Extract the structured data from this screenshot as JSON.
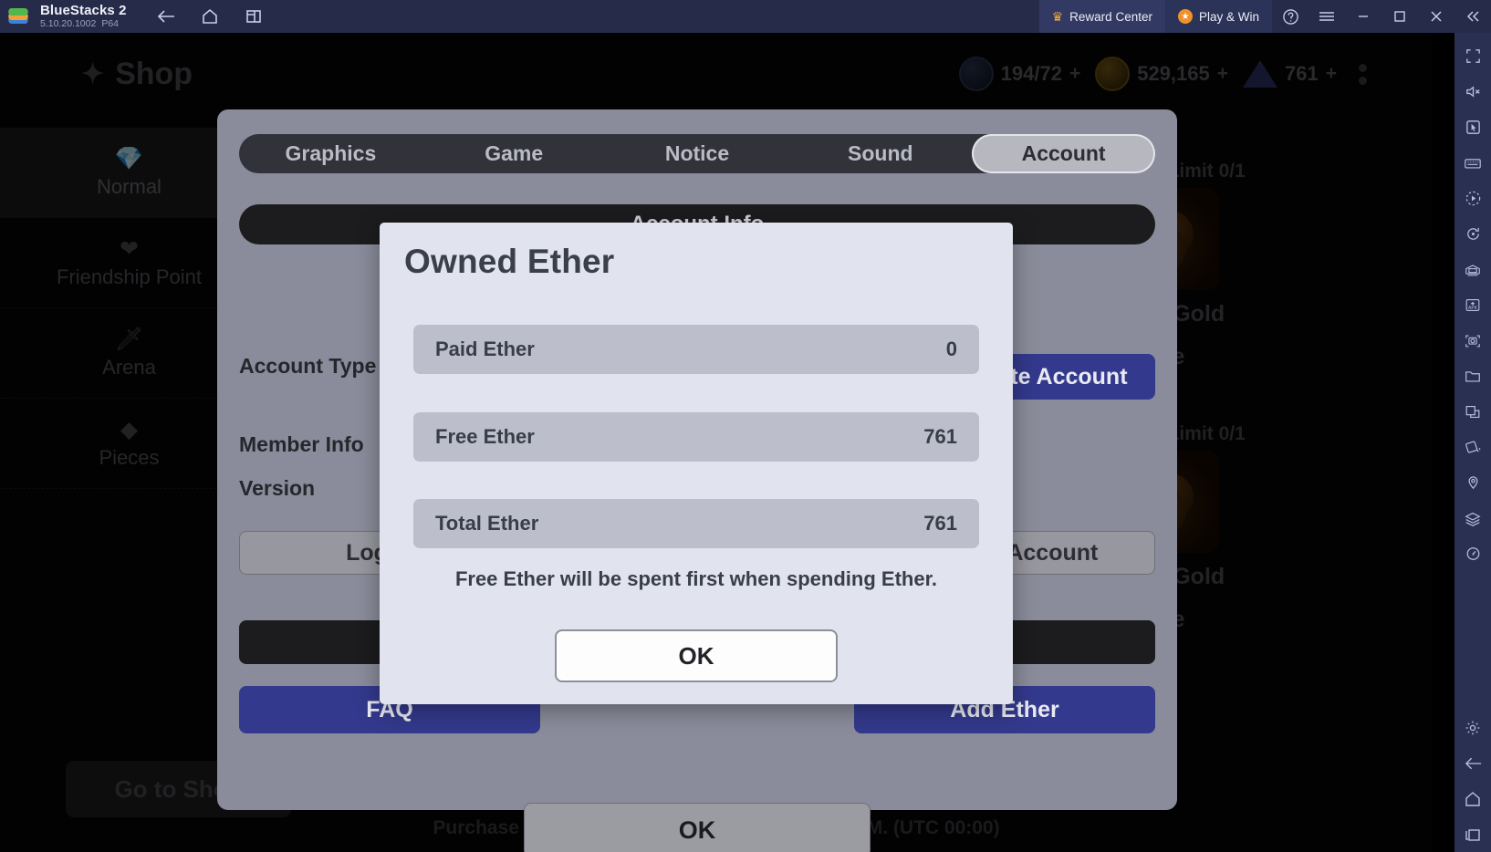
{
  "bluestacks": {
    "title": "BlueStacks 2",
    "version": "5.10.20.1002",
    "arch": "P64",
    "nav": [
      {
        "name": "back",
        "glyph": "←"
      },
      {
        "name": "home",
        "glyph": "⌂"
      },
      {
        "name": "multi-instance",
        "glyph": "❐"
      }
    ],
    "reward_center": "Reward Center",
    "play_and_win": "Play & Win",
    "help": "?",
    "menu": "☰",
    "minimize": "—",
    "maximize": "☐",
    "close": "✕",
    "collapse": "«",
    "accent_navy": "#262b4a",
    "accent_orange": "#f0a93c"
  },
  "sidebar": {
    "icons": [
      "fullscreen-icon",
      "mute-icon",
      "cursor-icon",
      "keyboard-icon",
      "macro-play-icon",
      "rotate-icon",
      "multi-instance-manager-icon",
      "apk-install-icon",
      "screenshot-icon",
      "folder-icon",
      "copy-icon",
      "tilt-icon",
      "location-icon",
      "layers-icon",
      "performance-icon"
    ],
    "bottom_icons": [
      "settings-gear-icon",
      "back-arrow-icon",
      "home-icon",
      "recents-icon"
    ]
  },
  "game": {
    "shop_title": "Shop",
    "nav": [
      {
        "label": "Normal",
        "icon": "diamond-icon",
        "active": true
      },
      {
        "label": "Friendship Point",
        "icon": "heart-icon",
        "active": false
      },
      {
        "label": "Arena",
        "icon": "sword-icon",
        "active": false
      },
      {
        "label": "Pieces",
        "icon": "gem-shard-icon",
        "active": false
      }
    ],
    "go_to_shop": "Go to Shop",
    "hud": [
      {
        "name": "stamina",
        "value": "194/72",
        "icon": "compass-icon"
      },
      {
        "name": "gold",
        "value": "529,165",
        "icon": "gold-coin-icon"
      },
      {
        "name": "ether",
        "value": "761",
        "icon": "ether-gem-icon"
      }
    ],
    "hud_plus": "+",
    "products": [
      {
        "limit": "Purchase Limit 0/1",
        "name": "10,000 Gold",
        "price": "Free"
      },
      {
        "limit": "Purchase Limit 0/1",
        "name": "10,000 Gold",
        "price": "Free"
      }
    ],
    "bottom_note": "Purchase limit info will be refreshed daily at 9 AM. (UTC 00:00)"
  },
  "settings": {
    "tabs": [
      {
        "label": "Graphics",
        "active": false
      },
      {
        "label": "Game",
        "active": false
      },
      {
        "label": "Notice",
        "active": false
      },
      {
        "label": "Sound",
        "active": false
      },
      {
        "label": "Account",
        "active": true
      }
    ],
    "account_info_header": "Account Info",
    "rows": [
      {
        "label": "Account Type"
      },
      {
        "label": "Member Info"
      },
      {
        "label": "Version"
      }
    ],
    "delete_account": "Delete Account",
    "logout": "Log Out",
    "transfer_account": "Transfer Account",
    "dark_bar": "",
    "faq": "FAQ",
    "add_ether": "Add Ether",
    "ok": "OK"
  },
  "ether_dialog": {
    "title": "Owned Ether",
    "rows": [
      {
        "label": "Paid Ether",
        "value": "0"
      },
      {
        "label": "Free Ether",
        "value": "761"
      },
      {
        "label": "Total Ether",
        "value": "761"
      }
    ],
    "note": "Free Ether will be spent first when spending Ether.",
    "ok": "OK"
  }
}
